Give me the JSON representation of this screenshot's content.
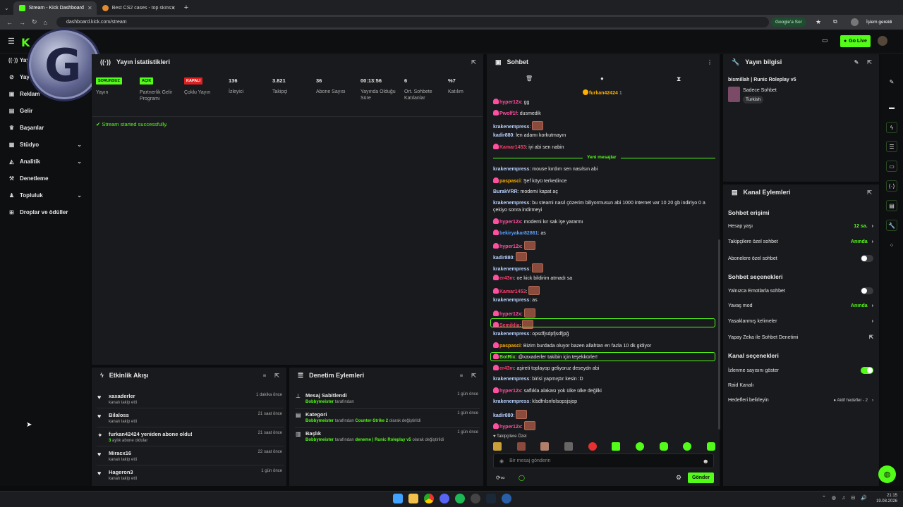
{
  "browser": {
    "tabs": [
      {
        "title": "Stream - Kick Dashboard"
      },
      {
        "title": "Best CS2 cases - top skins in CS..."
      }
    ],
    "url": "dashboard.kick.com/stream",
    "google_btn": "Google'a Sor",
    "profile_btn": "İşlem gerekli"
  },
  "header": {
    "go_live": "Go Live"
  },
  "sidebar": {
    "items": [
      {
        "label": "Yayın"
      },
      {
        "label": "Yayın"
      },
      {
        "label": "Reklam"
      },
      {
        "label": "Gelir"
      },
      {
        "label": "Başarılar"
      },
      {
        "label": "Stüdyo"
      },
      {
        "label": "Analitik"
      },
      {
        "label": "Denetleme"
      },
      {
        "label": "Topluluk"
      },
      {
        "label": "Droplar ve ödüller"
      }
    ]
  },
  "stats": {
    "title": "Yayın İstatistikleri",
    "items": [
      {
        "badge": "SORUNSUZ",
        "label": "Yayın"
      },
      {
        "badge": "AÇIK",
        "label": "Partnerlik Gelir Programı"
      },
      {
        "badge": "KAPALI",
        "label": "Çoklu Yayın"
      },
      {
        "value": "136",
        "label": "İzleyici"
      },
      {
        "value": "3.821",
        "label": "Takipçi"
      },
      {
        "value": "36",
        "label": "Abone Sayısı"
      },
      {
        "value": "00:13:56",
        "label": "Yayında Olduğu Süre"
      },
      {
        "value": "6",
        "label": "Ort. Sohbete Katılanlar"
      },
      {
        "value": "%7",
        "label": "Katılım"
      }
    ],
    "log": "Stream started successfully."
  },
  "activity": {
    "title": "Etkinlik Akışı",
    "rows": [
      {
        "name": "xaxaderler",
        "sub": "kanalı takip etti",
        "time": "1 dakika önce"
      },
      {
        "name": "Bilaloss",
        "sub": "kanalı takip etti",
        "time": "21 saat önce"
      },
      {
        "name": "furkan42424 yeniden abone oldu!",
        "sub_green": "3",
        "sub": "aylık abone oldular",
        "time": "21 saat önce"
      },
      {
        "name": "Miracx16",
        "sub": "kanalı takip etti",
        "time": "22 saat önce"
      },
      {
        "name": "Hageron3",
        "sub": "kanalı takip etti",
        "time": "1 gün önce"
      }
    ]
  },
  "moderation": {
    "title": "Denetim Eylemleri",
    "rows": [
      {
        "name": "Mesaj Sabitlendi",
        "user": "Bobbymeister",
        "rest": "tarafından",
        "time": "1 gün önce"
      },
      {
        "name": "Kategori",
        "user": "Bobbymeister",
        "rest": "tarafından",
        "hl": "Counter-Strike 2",
        "rest2": "olarak değiştirildi",
        "time": "1 gün önce"
      },
      {
        "name": "Başlık",
        "user": "Bobbymeister",
        "rest": "tarafından",
        "hl": "deneme | Runic Roleplay v5",
        "rest2": "olarak değiştirildi",
        "time": "1 gün önce"
      }
    ]
  },
  "chat": {
    "title": "Sohbet",
    "pinned_user": "furkan42424",
    "pinned_count": "1",
    "new_messages": "Yeni mesajlar",
    "input_placeholder": "Bir mesaj gönderin",
    "send": "Gönder",
    "followers_only": "Takipçilere Özel",
    "messages": [
      {
        "user": "hyper12x",
        "color": "#ff4fa0",
        "text": "gg"
      },
      {
        "user": "Pwolf1f",
        "color": "#ff4fa0",
        "text": "dusmedik"
      },
      {
        "user": "krakenempress",
        "color": "#b8d1ff",
        "text": "",
        "emote": true
      },
      {
        "user": "kadir880",
        "color": "#b8d1ff",
        "text": "len adamı korkutmayın"
      },
      {
        "user": "Kamar1453",
        "color": "#ff3b6b",
        "text": "iyi abi sen nabin"
      },
      {
        "user": "krakenempress",
        "color": "#b8d1ff",
        "text": "mouse kırdım sen nasılsın abi"
      },
      {
        "user": "paspasci",
        "color": "#ffb000",
        "text": "Şef köyü terkedince"
      },
      {
        "user": "BurakVRR",
        "color": "#b8d1ff",
        "text": "modemi kapat aç"
      },
      {
        "user": "krakenempress",
        "color": "#b8d1ff",
        "text": "bu steami nasıl çözerim biliyormusun abi 1000 internet var 10 20 gb indiriyo 0 a çekiyo sonra indirmeyi"
      },
      {
        "user": "hyper12x",
        "color": "#ff4fa0",
        "text": "modemi kır sak işe yararmı"
      },
      {
        "user": "bekiryakar82861",
        "color": "#5aa0ff",
        "text": "as"
      },
      {
        "user": "hyper12x",
        "color": "#ff4fa0",
        "text": "",
        "emote": true
      },
      {
        "user": "kadir880",
        "color": "#b8d1ff",
        "text": "",
        "emote": true
      },
      {
        "user": "krakenempress",
        "color": "#b8d1ff",
        "text": "",
        "emote": true
      },
      {
        "user": "er43m",
        "color": "#ff3b6b",
        "text": "oe kick bildirim atmadı sa"
      },
      {
        "user": "Kamar1453",
        "color": "#ff3b6b",
        "text": "",
        "emote": true
      },
      {
        "user": "krakenempress",
        "color": "#b8d1ff",
        "text": "as"
      },
      {
        "user": "hyper12x",
        "color": "#ff4fa0",
        "text": "",
        "emote": true
      },
      {
        "user": "Semiklia",
        "color": "#ff3b6b",
        "text": "",
        "emote": true
      },
      {
        "user": "krakenempress",
        "color": "#b8d1ff",
        "text": "opsdfjsdpfjsdfjpğ"
      },
      {
        "user": "paspasci",
        "color": "#ffb000",
        "text": "Bizim burdada oluyor bazen allahtan en fazla 10 dk gidiyor"
      },
      {
        "user": "BotRix",
        "color": "#53fc18",
        "text": "@xaxaderler takibin için teşekkürler!"
      },
      {
        "user": "er43m",
        "color": "#ff3b6b",
        "text": "aşireti toplayop geliyoruz deseydn abi"
      },
      {
        "user": "krakenempress",
        "color": "#b8d1ff",
        "text": "birisi yapmıştır kesin :D"
      },
      {
        "user": "hyper12x",
        "color": "#ff4fa0",
        "text": "saflıkla alakası yok ülke ülke değilki"
      },
      {
        "user": "krakenempress",
        "color": "#b8d1ff",
        "text": "klsdfnlsnfolsopsjsjop"
      },
      {
        "user": "kadir880",
        "color": "#b8d1ff",
        "text": "",
        "emote": true
      },
      {
        "user": "hyper12x",
        "color": "#ff4fa0",
        "text": "",
        "emote": true
      }
    ]
  },
  "info": {
    "title": "Yayın bilgisi",
    "stream_title": "bismillah | Runic Roleplay v5",
    "category": "Sadece Sohbet",
    "tag": "Turkish"
  },
  "actions": {
    "title": "Kanal Eylemleri",
    "sections": [
      {
        "heading": "Sohbet erişimi"
      },
      {
        "heading": "Sohbet seçenekleri"
      },
      {
        "heading": "Kanal seçenekleri"
      }
    ],
    "rows": {
      "account_age": "Hesap yaşı",
      "account_age_val": "12 sa.",
      "followers_chat": "Takipçilere özel sohbet",
      "followers_chat_val": "Anında",
      "subs_chat": "Abonelere özel sohbet",
      "emote_only": "Yalnızca Emotlarla sohbet",
      "slow_mode": "Yavaş mod",
      "slow_mode_val": "Anında",
      "banned_words": "Yasaklanmış kelimeler",
      "ai_mod": "Yapay Zeka ile Sohbet Denetimi",
      "show_viewers": "İzlenme sayısını göster",
      "raid": "Raid Kanalı",
      "goals": "Hedefleri belirleyin",
      "goals_val": "Aktif hedefler - 2"
    }
  },
  "taskbar": {
    "time": "21:15",
    "date": "19.08.2026"
  },
  "colors": {
    "accent": "#53fc18",
    "panel": "#191a1d",
    "bg": "#0b0c0e"
  }
}
